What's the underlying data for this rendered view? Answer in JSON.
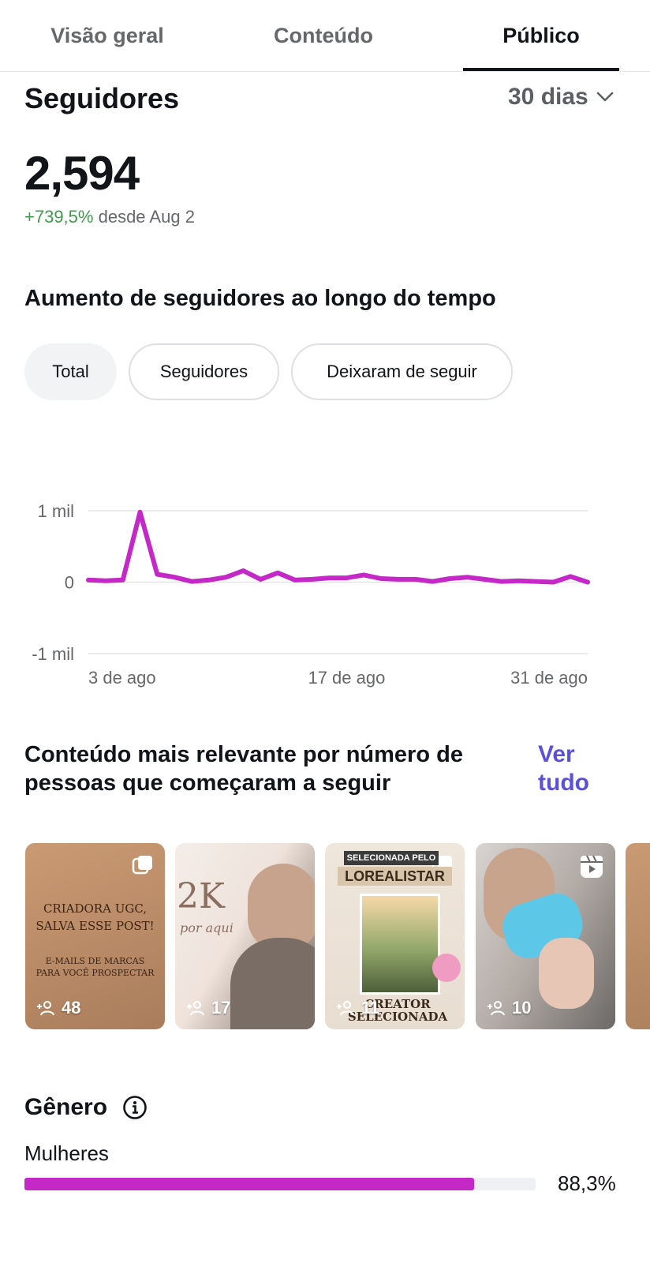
{
  "tabs": [
    {
      "label": "Visão geral"
    },
    {
      "label": "Conteúdo"
    },
    {
      "label": "Público",
      "active": true
    }
  ],
  "followers": {
    "title": "Seguidores",
    "range_label": "30 dias",
    "total": "2,594",
    "growth_pct": "+739,5%",
    "growth_since": "desde Aug 2"
  },
  "growth_chart": {
    "title": "Aumento de seguidores ao longo do tempo",
    "filters": [
      "Total",
      "Seguidores",
      "Deixaram de seguir"
    ],
    "selected_filter": "Total"
  },
  "chart_data": {
    "type": "line",
    "title": "",
    "xlabel": "",
    "ylabel": "",
    "y_tick_labels": [
      "1 mil",
      "0",
      "-1 mil"
    ],
    "x_tick_labels": [
      "3 de ago",
      "17 de ago",
      "31 de ago"
    ],
    "ylim": [
      -1000,
      1000
    ],
    "grid": true,
    "color": "#c429c8",
    "x": [
      "2 de ago",
      "3 de ago",
      "4 de ago",
      "5 de ago",
      "6 de ago",
      "7 de ago",
      "8 de ago",
      "9 de ago",
      "10 de ago",
      "11 de ago",
      "12 de ago",
      "13 de ago",
      "14 de ago",
      "15 de ago",
      "16 de ago",
      "17 de ago",
      "18 de ago",
      "19 de ago",
      "20 de ago",
      "21 de ago",
      "22 de ago",
      "23 de ago",
      "24 de ago",
      "25 de ago",
      "26 de ago",
      "27 de ago",
      "28 de ago",
      "29 de ago",
      "30 de ago",
      "31 de ago"
    ],
    "values": [
      30,
      20,
      30,
      980,
      110,
      70,
      10,
      30,
      70,
      160,
      40,
      130,
      30,
      40,
      60,
      60,
      100,
      50,
      40,
      40,
      10,
      50,
      70,
      40,
      10,
      20,
      10,
      0,
      80,
      0
    ]
  },
  "top_content": {
    "title": "Conteúdo mais relevante por número de pessoas que começaram a seguir",
    "see_all": "Ver tudo",
    "items": [
      {
        "count": "48",
        "type_icon": "carousel-icon",
        "text1": "CRIADORA UGC, SALVA ESSE POST!",
        "text2": "E-MAILS DE MARCAS PARA VOCÊ PROSPECTAR"
      },
      {
        "count": "17",
        "big_text": "2K",
        "small_text": "por aqui"
      },
      {
        "count": "11",
        "type_icon": "carousel-icon",
        "banner": "SELECIONADA PELO",
        "brand": "LOREALISTAR",
        "footer": "CREATOR SELECIONADA"
      },
      {
        "count": "10",
        "type_icon": "reels-icon"
      },
      {
        "count": ""
      }
    ]
  },
  "gender": {
    "title": "Gênero",
    "women_label": "Mulheres",
    "women_pct": "88,3%",
    "women_value": 88.3
  }
}
